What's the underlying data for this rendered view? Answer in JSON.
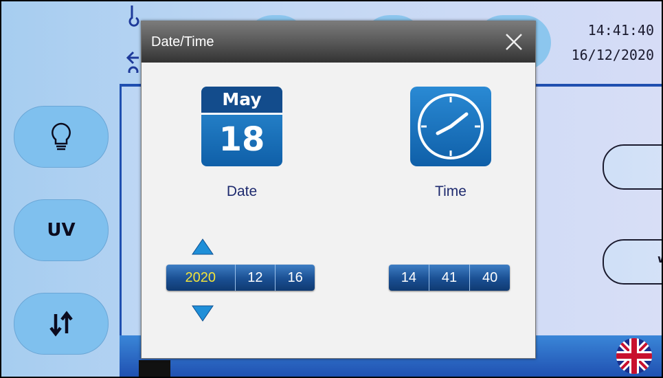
{
  "background": {
    "clock_time": "14:41:40",
    "clock_date": "16/12/2020",
    "side_buttons": [
      {
        "label": "",
        "icon": "lightbulb-icon"
      },
      {
        "label": "UV",
        "icon": ""
      },
      {
        "label": "",
        "icon": "up-down-arrows-icon"
      }
    ],
    "right_controls": [
      {
        "icon": "calendar-clock-icon"
      },
      {
        "fragment": "w",
        "icon": "circled-up-down-arrows-icon"
      }
    ],
    "flag_icon": "uk-flag-icon"
  },
  "dialog": {
    "title": "Date/Time",
    "close_icon": "close-icon",
    "calendar_icon": {
      "month": "May",
      "day": "18"
    },
    "date_label": "Date",
    "time_label": "Time",
    "clock_icon": "clock-icon",
    "date_fields": {
      "year": "2020",
      "month": "12",
      "day": "16"
    },
    "time_fields": {
      "hours": "14",
      "minutes": "41",
      "seconds": "40"
    },
    "active_field": "year",
    "arrow_up_icon": "triangle-up-icon",
    "arrow_down_icon": "triangle-down-icon"
  },
  "colors": {
    "accent": "#1f4fb0",
    "active_digit": "#f2e33a",
    "icon_blue": "#1e73be"
  }
}
